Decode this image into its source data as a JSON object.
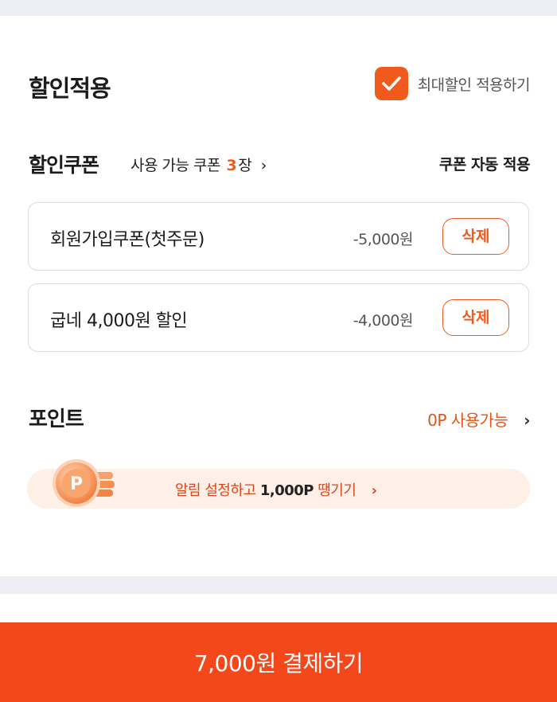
{
  "discount": {
    "title": "할인적용",
    "max_apply_label": "최대할인 적용하기",
    "max_apply_checked": true
  },
  "coupon": {
    "title": "할인쿠폰",
    "available_prefix": "사용 가능 쿠폰",
    "available_count": "3",
    "available_suffix": "장",
    "auto_apply_label": "쿠폰 자동 적용",
    "items": [
      {
        "name": "회원가입쿠폰(첫주문)",
        "amount": "-5,000원",
        "delete_label": "삭제"
      },
      {
        "name": "굽네 4,000원 할인",
        "amount": "-4,000원",
        "delete_label": "삭제"
      }
    ]
  },
  "point": {
    "title": "포인트",
    "available_label": "0P 사용가능",
    "promo_prefix": "알림 설정하고",
    "promo_highlight": "1,000P",
    "promo_suffix": "땡기기",
    "coin_letter": "P"
  },
  "payment": {
    "button_label": "7,000원 결제하기"
  },
  "colors": {
    "accent": "#f05a1c",
    "pay_button": "#f4471a",
    "promo_bg": "#fff0e7",
    "section_band": "#eeeff5"
  }
}
